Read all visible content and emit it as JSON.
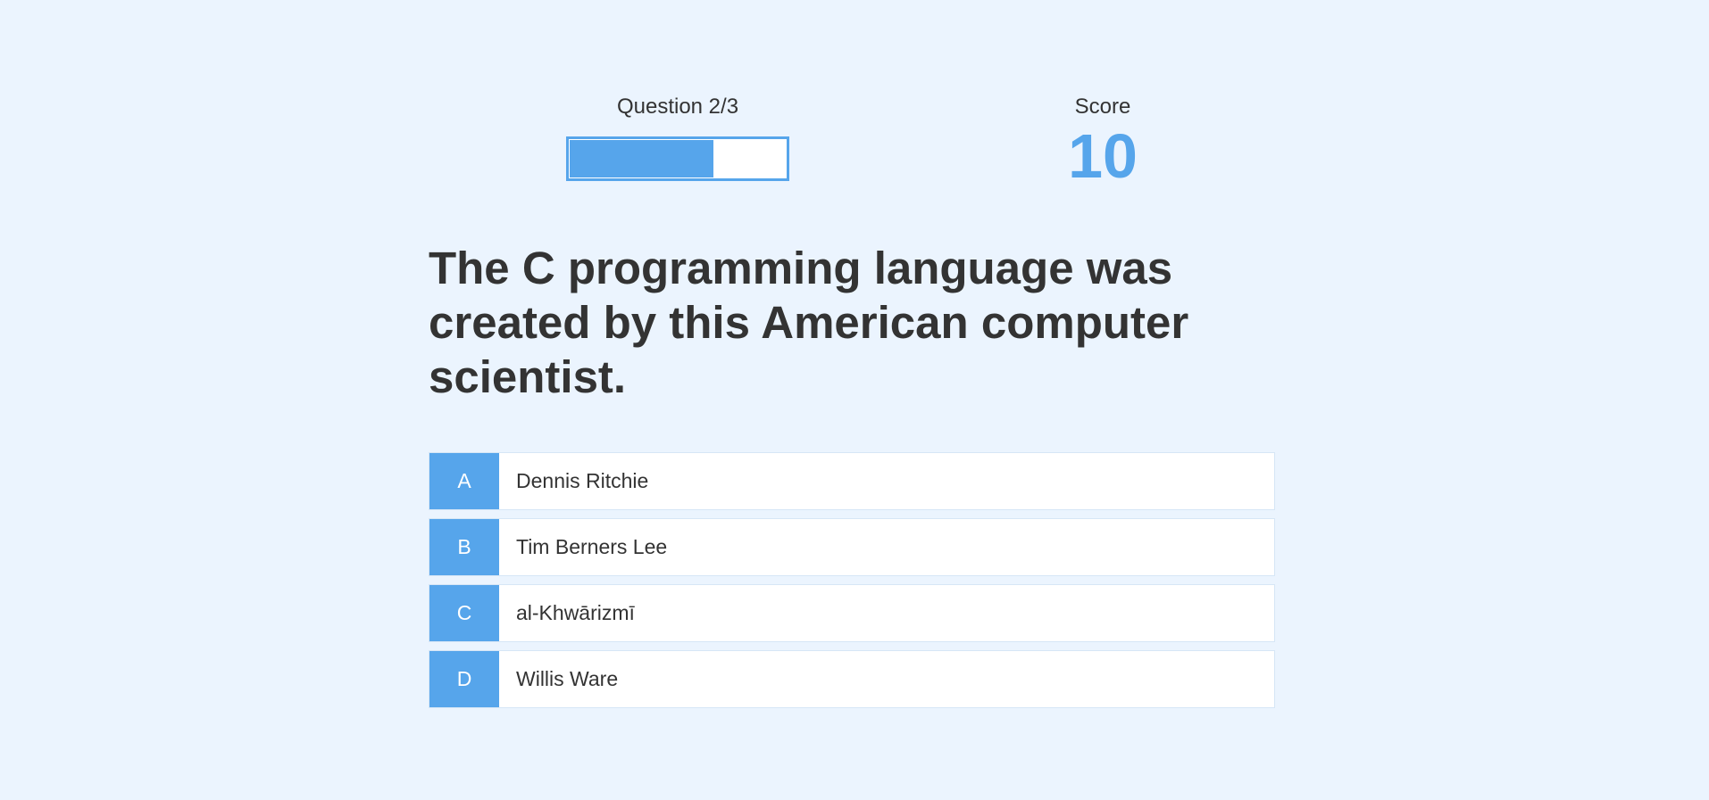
{
  "hud": {
    "progress_label": "Question 2/3",
    "progress_fraction": 0.667,
    "score_label": "Score",
    "score_value": "10"
  },
  "question": {
    "text": "The C programming language was created by this American computer scientist."
  },
  "choices": [
    {
      "prefix": "A",
      "text": "Dennis Ritchie"
    },
    {
      "prefix": "B",
      "text": "Tim Berners Lee"
    },
    {
      "prefix": "C",
      "text": "al-Khwārizmī"
    },
    {
      "prefix": "D",
      "text": "Willis Ware"
    }
  ],
  "colors": {
    "background": "#ebf4fe",
    "accent": "#56a5eb",
    "text": "#333333",
    "choice_background": "#ffffff"
  }
}
